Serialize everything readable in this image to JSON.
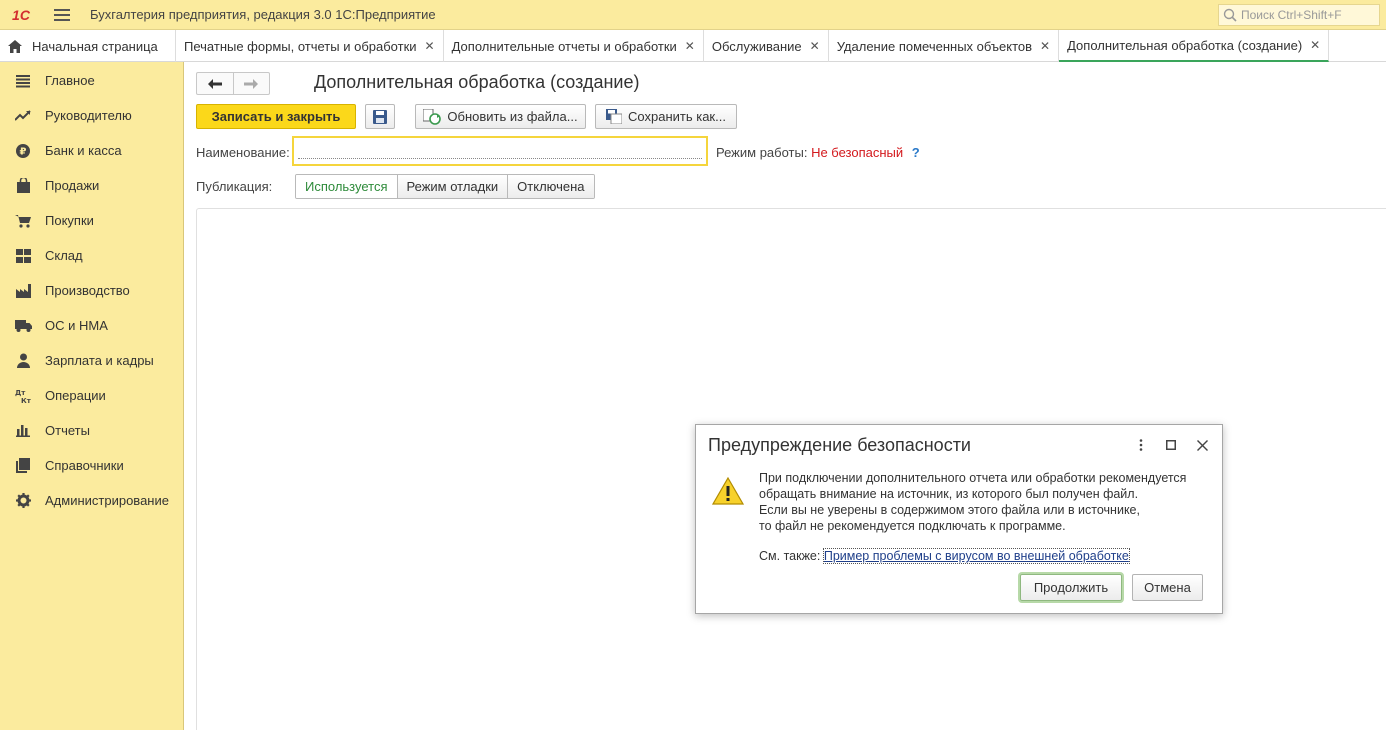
{
  "app": {
    "logo": "1С",
    "title": "Бухгалтерия предприятия, редакция 3.0 1С:Предприятие",
    "search_placeholder": "Поиск Ctrl+Shift+F"
  },
  "tabs": [
    {
      "label": "Начальная страница",
      "closable": false
    },
    {
      "label": "Печатные формы, отчеты и обработки",
      "closable": true
    },
    {
      "label": "Дополнительные отчеты и обработки",
      "closable": true
    },
    {
      "label": "Обслуживание",
      "closable": true
    },
    {
      "label": "Удаление помеченных объектов",
      "closable": true
    },
    {
      "label": "Дополнительная обработка (создание)",
      "closable": true,
      "active": true
    }
  ],
  "sidebar": {
    "items": [
      {
        "label": "Главное",
        "icon": "list-icon"
      },
      {
        "label": "Руководителю",
        "icon": "trend-icon"
      },
      {
        "label": "Банк и касса",
        "icon": "ruble-icon"
      },
      {
        "label": "Продажи",
        "icon": "bag-icon"
      },
      {
        "label": "Покупки",
        "icon": "cart-icon"
      },
      {
        "label": "Склад",
        "icon": "warehouse-icon"
      },
      {
        "label": "Производство",
        "icon": "factory-icon"
      },
      {
        "label": "ОС и НМА",
        "icon": "truck-icon"
      },
      {
        "label": "Зарплата и кадры",
        "icon": "person-icon"
      },
      {
        "label": "Операции",
        "icon": "dt-kt-icon"
      },
      {
        "label": "Отчеты",
        "icon": "bar-chart-icon"
      },
      {
        "label": "Справочники",
        "icon": "books-icon"
      },
      {
        "label": "Администрирование",
        "icon": "gear-icon"
      }
    ]
  },
  "form": {
    "title": "Дополнительная обработка (создание)",
    "save_close_label": "Записать и закрыть",
    "update_from_file_label": "Обновить из файла...",
    "save_as_label": "Сохранить как...",
    "name_label": "Наименование:",
    "name_value": "",
    "mode_label": "Режим работы:",
    "mode_value": "Не безопасный",
    "mode_help": "?",
    "publication_label": "Публикация:",
    "publication_options": [
      "Используется",
      "Режим отладки",
      "Отключена"
    ],
    "publication_selected": "Используется"
  },
  "dialog": {
    "title": "Предупреждение безопасности",
    "message_lines": [
      "При подключении дополнительного отчета или обработки рекомендуется",
      "обращать внимание на источник, из которого был получен файл.",
      "Если вы не уверены в содержимом этого файла или в источнике,",
      "то файл не рекомендуется подключать к программе."
    ],
    "see_also_label": "См. также:",
    "see_also_link": "Пример проблемы с вирусом во внешней обработке",
    "continue_label": "Продолжить",
    "cancel_label": "Отмена"
  },
  "colors": {
    "panel_yellow": "#fbeb9e",
    "primary_button": "#fbd81a",
    "unsafe_red": "#d3191d",
    "active_green": "#2e8b3a"
  }
}
